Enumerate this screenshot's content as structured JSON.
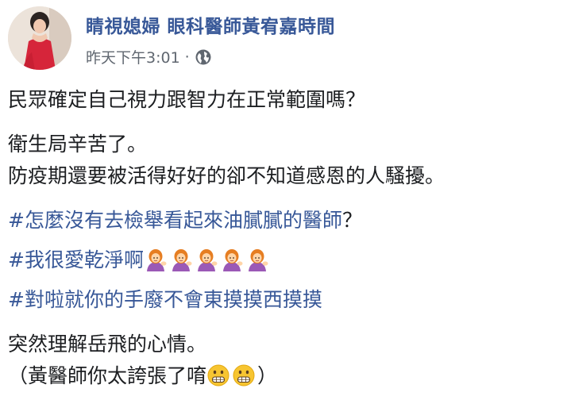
{
  "post": {
    "author": "睛視媳婦 眼科醫師黃宥嘉時間",
    "timestamp": "昨天下午3:01",
    "separator": "·",
    "privacy_icon": "globe-icon",
    "lines": {
      "line1": "民眾確定自己視力跟智力在正常範圍嗎？",
      "line2": "衛生局辛苦了。",
      "line3": "防疫期還要被活得好好的卻不知道感恩的人騷擾。",
      "hashtag1": "#怎麼沒有去檢舉看起來油膩膩的醫師",
      "hashtag1_suffix": "？",
      "hashtag2": "#我很愛乾淨啊",
      "hashtag2_emoji": [
        "woman-tipping-hand",
        "woman-tipping-hand",
        "woman-tipping-hand",
        "woman-tipping-hand",
        "woman-tipping-hand"
      ],
      "hashtag3": "#對啦就你的手廢不會東摸摸西摸摸",
      "line7": "突然理解岳飛的心情。",
      "line8_prefix": "（黃醫師你太誇張了唷",
      "line8_emoji": [
        "grimacing-face",
        "grimacing-face"
      ],
      "line8_suffix": "）"
    }
  }
}
